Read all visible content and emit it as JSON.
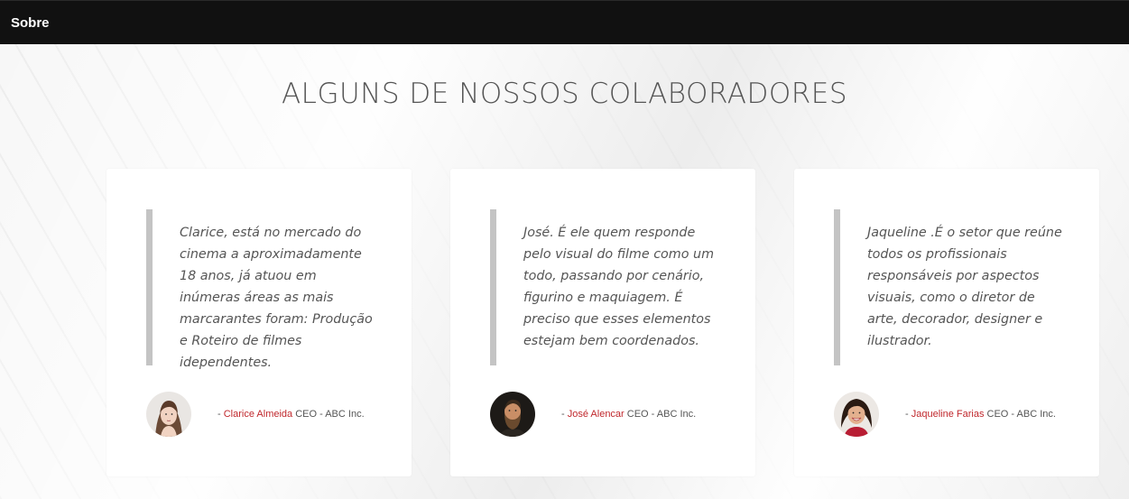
{
  "navbar": {
    "brand": "Sobre"
  },
  "section": {
    "title": "ALGUNS DE NOSSOS COLABORADORES"
  },
  "testimonials": [
    {
      "quote": "Clarice, está no mercado do cinema a aproximadamente 18 anos, já atuou em inúmeras áreas as mais marcarantes foram: Produção e Roteiro de filmes idependentes.",
      "dash": "- ",
      "name": "Clarice Almeida",
      "role": " CEO - ABC Inc.",
      "avatar_icon": "woman-portrait"
    },
    {
      "quote": "José. É ele quem responde pelo visual do filme como um todo, passando por cenário, figurino e maquiagem. É preciso que esses elementos estejam bem coordenados.",
      "dash": "- ",
      "name": "José Alencar",
      "role": " CEO - ABC Inc.",
      "avatar_icon": "bearded-man-portrait"
    },
    {
      "quote": "Jaqueline .É o setor que reúne todos os profissionais responsáveis por aspectos visuais, como o diretor de arte, decorador, designer e ilustrador.",
      "dash": "- ",
      "name": "Jaqueline Farias",
      "role": " CEO - ABC Inc.",
      "avatar_icon": "smiling-woman-portrait"
    }
  ],
  "colors": {
    "navbar": "#111111",
    "accent": "#c0282d",
    "quote_bar": "#c4c4c4"
  }
}
